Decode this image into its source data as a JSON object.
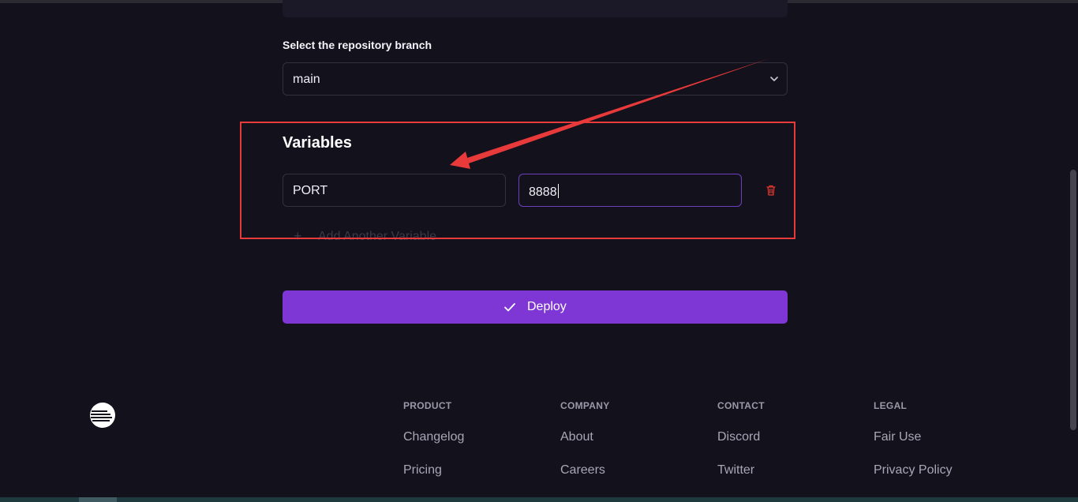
{
  "branch": {
    "label": "Select the repository branch",
    "selected": "main"
  },
  "variables": {
    "title": "Variables",
    "key_value": "PORT",
    "value_value": "8888",
    "add_label": "Add Another Variable"
  },
  "deploy": {
    "label": "Deploy"
  },
  "footer": {
    "product": {
      "heading": "PRODUCT",
      "links": [
        "Changelog",
        "Pricing"
      ]
    },
    "company": {
      "heading": "COMPANY",
      "links": [
        "About",
        "Careers"
      ]
    },
    "contact": {
      "heading": "CONTACT",
      "links": [
        "Discord",
        "Twitter"
      ]
    },
    "legal": {
      "heading": "LEGAL",
      "links": [
        "Fair Use",
        "Privacy Policy"
      ]
    }
  },
  "icons": {
    "chevron": "chevron-down-icon",
    "trash": "trash-icon",
    "plus": "plus-icon",
    "check": "check-icon",
    "logo": "railway-logo-icon"
  },
  "colors": {
    "background": "#13111c",
    "accent": "#7e36d4",
    "annotation": "#e83a3a",
    "danger": "#e0382f"
  }
}
